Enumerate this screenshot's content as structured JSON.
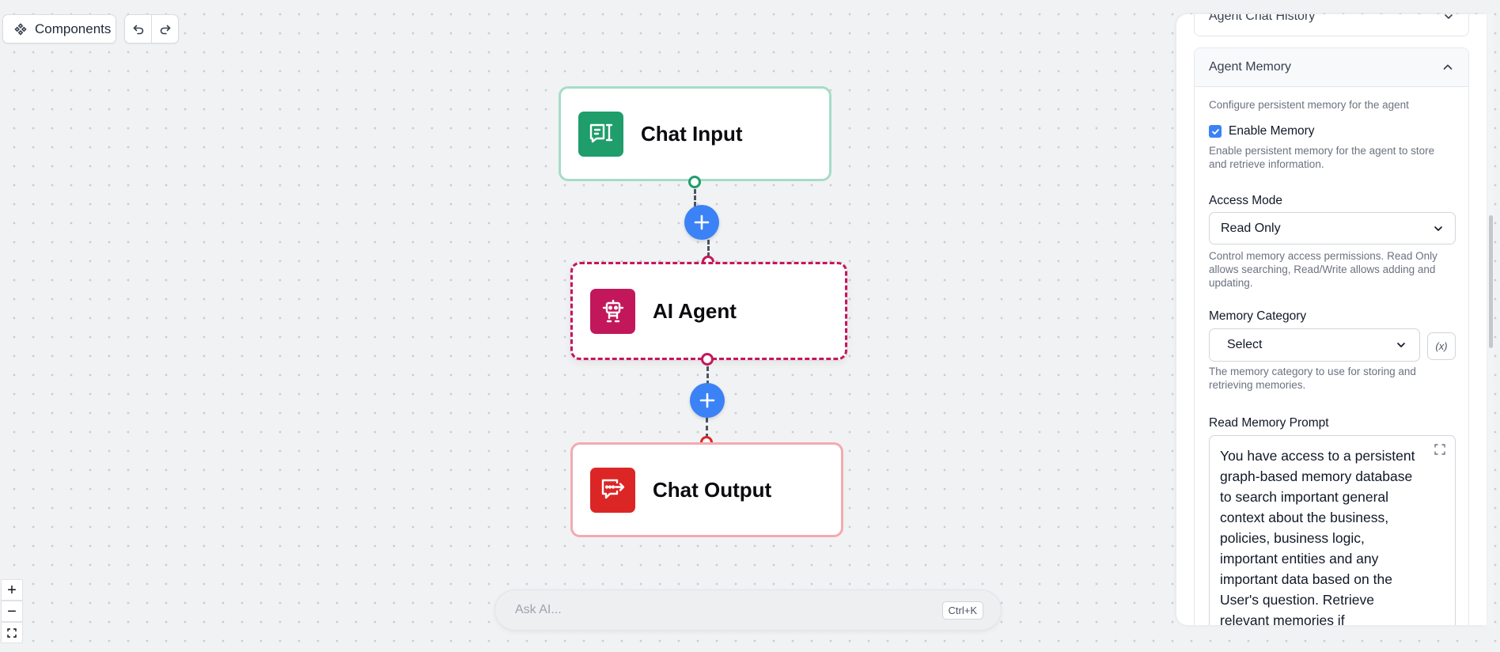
{
  "toolbar": {
    "components_label": "Components",
    "undo_icon": "undo-icon",
    "redo_icon": "redo-icon"
  },
  "nodes": {
    "chat_input": {
      "title": "Chat Input",
      "color": "#1f9d6b",
      "border": "#a7dcc6"
    },
    "ai_agent": {
      "title": "AI Agent",
      "color": "#c2185b",
      "border": "#c2185b"
    },
    "chat_output": {
      "title": "Chat Output",
      "color": "#dc2626",
      "border": "#f3aab0"
    }
  },
  "canvas": {
    "zoom_in": "+",
    "zoom_out": "−",
    "accent": "#3b82f6"
  },
  "ask_ai": {
    "placeholder": "Ask AI...",
    "shortcut": "Ctrl+K"
  },
  "panel": {
    "prev_section_title": "Agent Chat History",
    "memory_section": {
      "title": "Agent Memory",
      "description": "Configure persistent memory for the agent",
      "enable_memory": {
        "label": "Enable Memory",
        "checked": true,
        "help": "Enable persistent memory for the agent to store and retrieve information."
      },
      "access_mode": {
        "label": "Access Mode",
        "value": "Read Only",
        "help": "Control memory access permissions. Read Only allows searching, Read/Write allows adding and updating."
      },
      "memory_category": {
        "label": "Memory Category",
        "value": "Select",
        "variable_button": "(x)",
        "help": "The memory category to use for storing and retrieving memories."
      },
      "read_memory_prompt": {
        "label": "Read Memory Prompt",
        "value": "You have access to a persistent graph-based memory database to search important general context about the business, policies, business logic, important entities and any important data based on the User's question. Retrieve relevant memories if"
      }
    }
  }
}
